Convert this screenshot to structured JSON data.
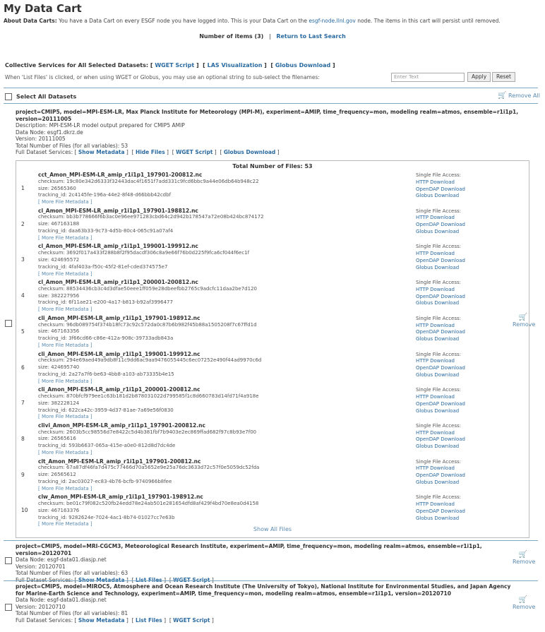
{
  "page": {
    "title": "My Data Cart",
    "about_label": "About Data Carts:",
    "about_text_pre": " You have a Data Cart on every ESGF node you have logged into. This is your Data Cart on the ",
    "about_link": "esgf-node.llnl.gov",
    "about_text_post": " node. The items in this cart will persist until removed.",
    "num_items": "Number of items (3)",
    "separator": "|",
    "return_link": "Return to Last Search"
  },
  "collective": {
    "label": "Collective Services for All Selected Datasets:",
    "wget": "WGET Script",
    "las": "LAS Visualization",
    "globus": "Globus Download",
    "hint": "When 'List Files' is clicked, or when using WGET or Globus, you may use an optional string to sub-select the filenames:",
    "placeholder": "Enter Text",
    "apply": "Apply",
    "reset": "Reset"
  },
  "select_all": "Select All Datasets",
  "remove_all": "Remove All",
  "remove": "Remove",
  "datasets": [
    {
      "head": "project=CMIP5, model=MPI-ESM-LR, Max Planck Institute for Meteorology (MPI-M), experiment=AMIP, time_frequency=mon, modeling realm=atmos, ensemble=r1i1p1, version=20111005",
      "description": "Description: MPI-ESM-LR model output prepared for CMIP5 AMIP",
      "node": "Data Node: esgf1.dkrz.de",
      "version": "Version: 20111005",
      "total": "Total Number of Files (for all variables): 53",
      "services_label": "Full Dataset Services:",
      "show_metadata": "Show Metadata",
      "toggle_files": "Hide Files",
      "wget": "WGET Script",
      "globus": "Globus Download"
    },
    {
      "head": "project=CMIP5, model=MRI-CGCM3, Meteorological Research Institute, experiment=AMIP, time_frequency=mon, modeling realm=atmos, ensemble=r1i1p1, version=20120701",
      "node": "Data Node: esgf-data01.diasjp.net",
      "version": "Version: 20120701",
      "total": "Total Number of Files (for all variables): 63",
      "services_label": "Full Dataset Services:",
      "show_metadata": "Show Metadata",
      "toggle_files": "List Files",
      "wget": "WGET Script"
    },
    {
      "head": "project=CMIP5, model=MIROC5, Atmosphere and Ocean Research Institute (The University of Tokyo), National Institute for Environmental Studies, and Japan Agency for Marine-Earth Science and Technology, experiment=AMIP, time_frequency=mon, modeling realm=atmos, ensemble=r1i1p1, version=20120710",
      "node": "Data Node: esgf-data01.diasjp.net",
      "version": "Version: 20120710",
      "total": "Total Number of Files (for all variables): 81",
      "services_label": "Full Dataset Services:",
      "show_metadata": "Show Metadata",
      "toggle_files": "List Files",
      "wget": "WGET Script"
    }
  ],
  "files_panel": {
    "total": "Total Number of Files: 53",
    "show_all": "Show All Files",
    "access_label": "Single File Access:",
    "http": "HTTP Download",
    "opendap": "OpenDAP Download",
    "globus": "Globus Download",
    "more": "[ More File Metadata ]",
    "files": [
      {
        "idx": "1",
        "name": "cct_Amon_MPI-ESM-LR_amip_r1i1p1_197901-200812.nc",
        "checksum": "checksum: 19c80e342d6333f32443dac4f1651f7add331c9fcd6bbc9a44e06db64b948c22",
        "size": "size: 26565360",
        "tracking": "tracking_id: 2c4145fe-196a-44e2-8f48-d66bbb42cdbf"
      },
      {
        "idx": "2",
        "name": "cl_Amon_MPI-ESM-LR_amip_r1i1p1_197901-198812.nc",
        "checksum": "checksum: bb3b778666f6b3ac0e96ee971283cbd64c2d942b178547a72e08b424bc874172",
        "size": "size: 467163188",
        "tracking": "tracking_id: daa63b33-9c73-4d5b-80c4-065c91a07af4"
      },
      {
        "idx": "3",
        "name": "cl_Amon_MPI-ESM-LR_amip_r1i1p1_199001-199912.nc",
        "checksum": "checksum: 3692f017a433f288b8f2f95dacdf306c8a9e66f76b0d225f9fca6cf044f6ec1f",
        "size": "size: 424695572",
        "tracking": "tracking_id: 4faf403a-f50c-45f2-81ef-cded374575e7"
      },
      {
        "idx": "4",
        "name": "cl_Amon_MPI-ESM-LR_amip_r1i1p1_200001-200812.nc",
        "checksum": "checksum: 88534436cb3c4d3dfae50eee1ff059e28dbeefbb2765c9adcfc11daa2be7d120",
        "size": "size: 382227956",
        "tracking": "tracking_id: 6f11ae21-e200-4a17-b813-b92af3996477"
      },
      {
        "idx": "5",
        "name": "cli_Amon_MPI-ESM-LR_amip_r1i1p1_197901-198912.nc",
        "checksum": "checksum: 96db089754f374b18fc73c92c572da0c87b6b982f45b88a1505208f7c67ffd1d",
        "size": "size: 467163356",
        "tracking": "tracking_id: 3f66cd66-c86e-412a-908c-39733adb843a"
      },
      {
        "idx": "6",
        "name": "cli_Amon_MPI-ESM-LR_amip_r1i1p1_199001-199912.nc",
        "checksum": "checksum: 294e69aed49a9db8f11c9dd6ac9aa9476055445c6ec07252e490f44ad9970c6d",
        "size": "size: 424695740",
        "tracking": "tracking_id: 2a27a7f6-be63-4bb8-a103-ab73335b4e15"
      },
      {
        "idx": "7",
        "name": "cli_Amon_MPI-ESM-LR_amip_r1i1p1_200001-200812.nc",
        "checksum": "checksum: 870bfcf979ee1c63b181d2b878031022d799585f1c8d660783d14fd71f4a918e",
        "size": "size: 382228124",
        "tracking": "tracking_id: 622ca42c-3959-4d37-81ae-7a69e56f0830"
      },
      {
        "idx": "8",
        "name": "clivi_Amon_MPI-ESM-LR_amip_r1i1p1_197901-200812.nc",
        "checksum": "checksum: 2603b5cc98556d7e8422c5d4b381fbf7b9403e2ec869ffad682f97c8b93e7f00",
        "size": "size: 26565616",
        "tracking": "tracking_id: 593b6637-065a-415e-a0e0-812d8d7dc4de"
      },
      {
        "idx": "9",
        "name": "clt_Amon_MPI-ESM-LR_amip_r1i1p1_197901-200812.nc",
        "checksum": "checksum: 67a87df46fa7d475c77466d70a5652e9e25a76dc3633d72c57f0e5059dc52fda",
        "size": "size: 26565612",
        "tracking": "tracking_id: 2ac03027-ec83-4b76-bcfb-9740966b8fee"
      },
      {
        "idx": "10",
        "name": "clw_Amon_MPI-ESM-LR_amip_r1i1p1_197901-198912.nc",
        "checksum": "checksum: be01c79f082c520fb24edd78e24ab501e281654dfd8af429f4bd70e8ea0d4158",
        "size": "size: 467163376",
        "tracking": "tracking_id: 9282624e-7024-4ac1-8b74-01027cc7e63b"
      }
    ]
  }
}
